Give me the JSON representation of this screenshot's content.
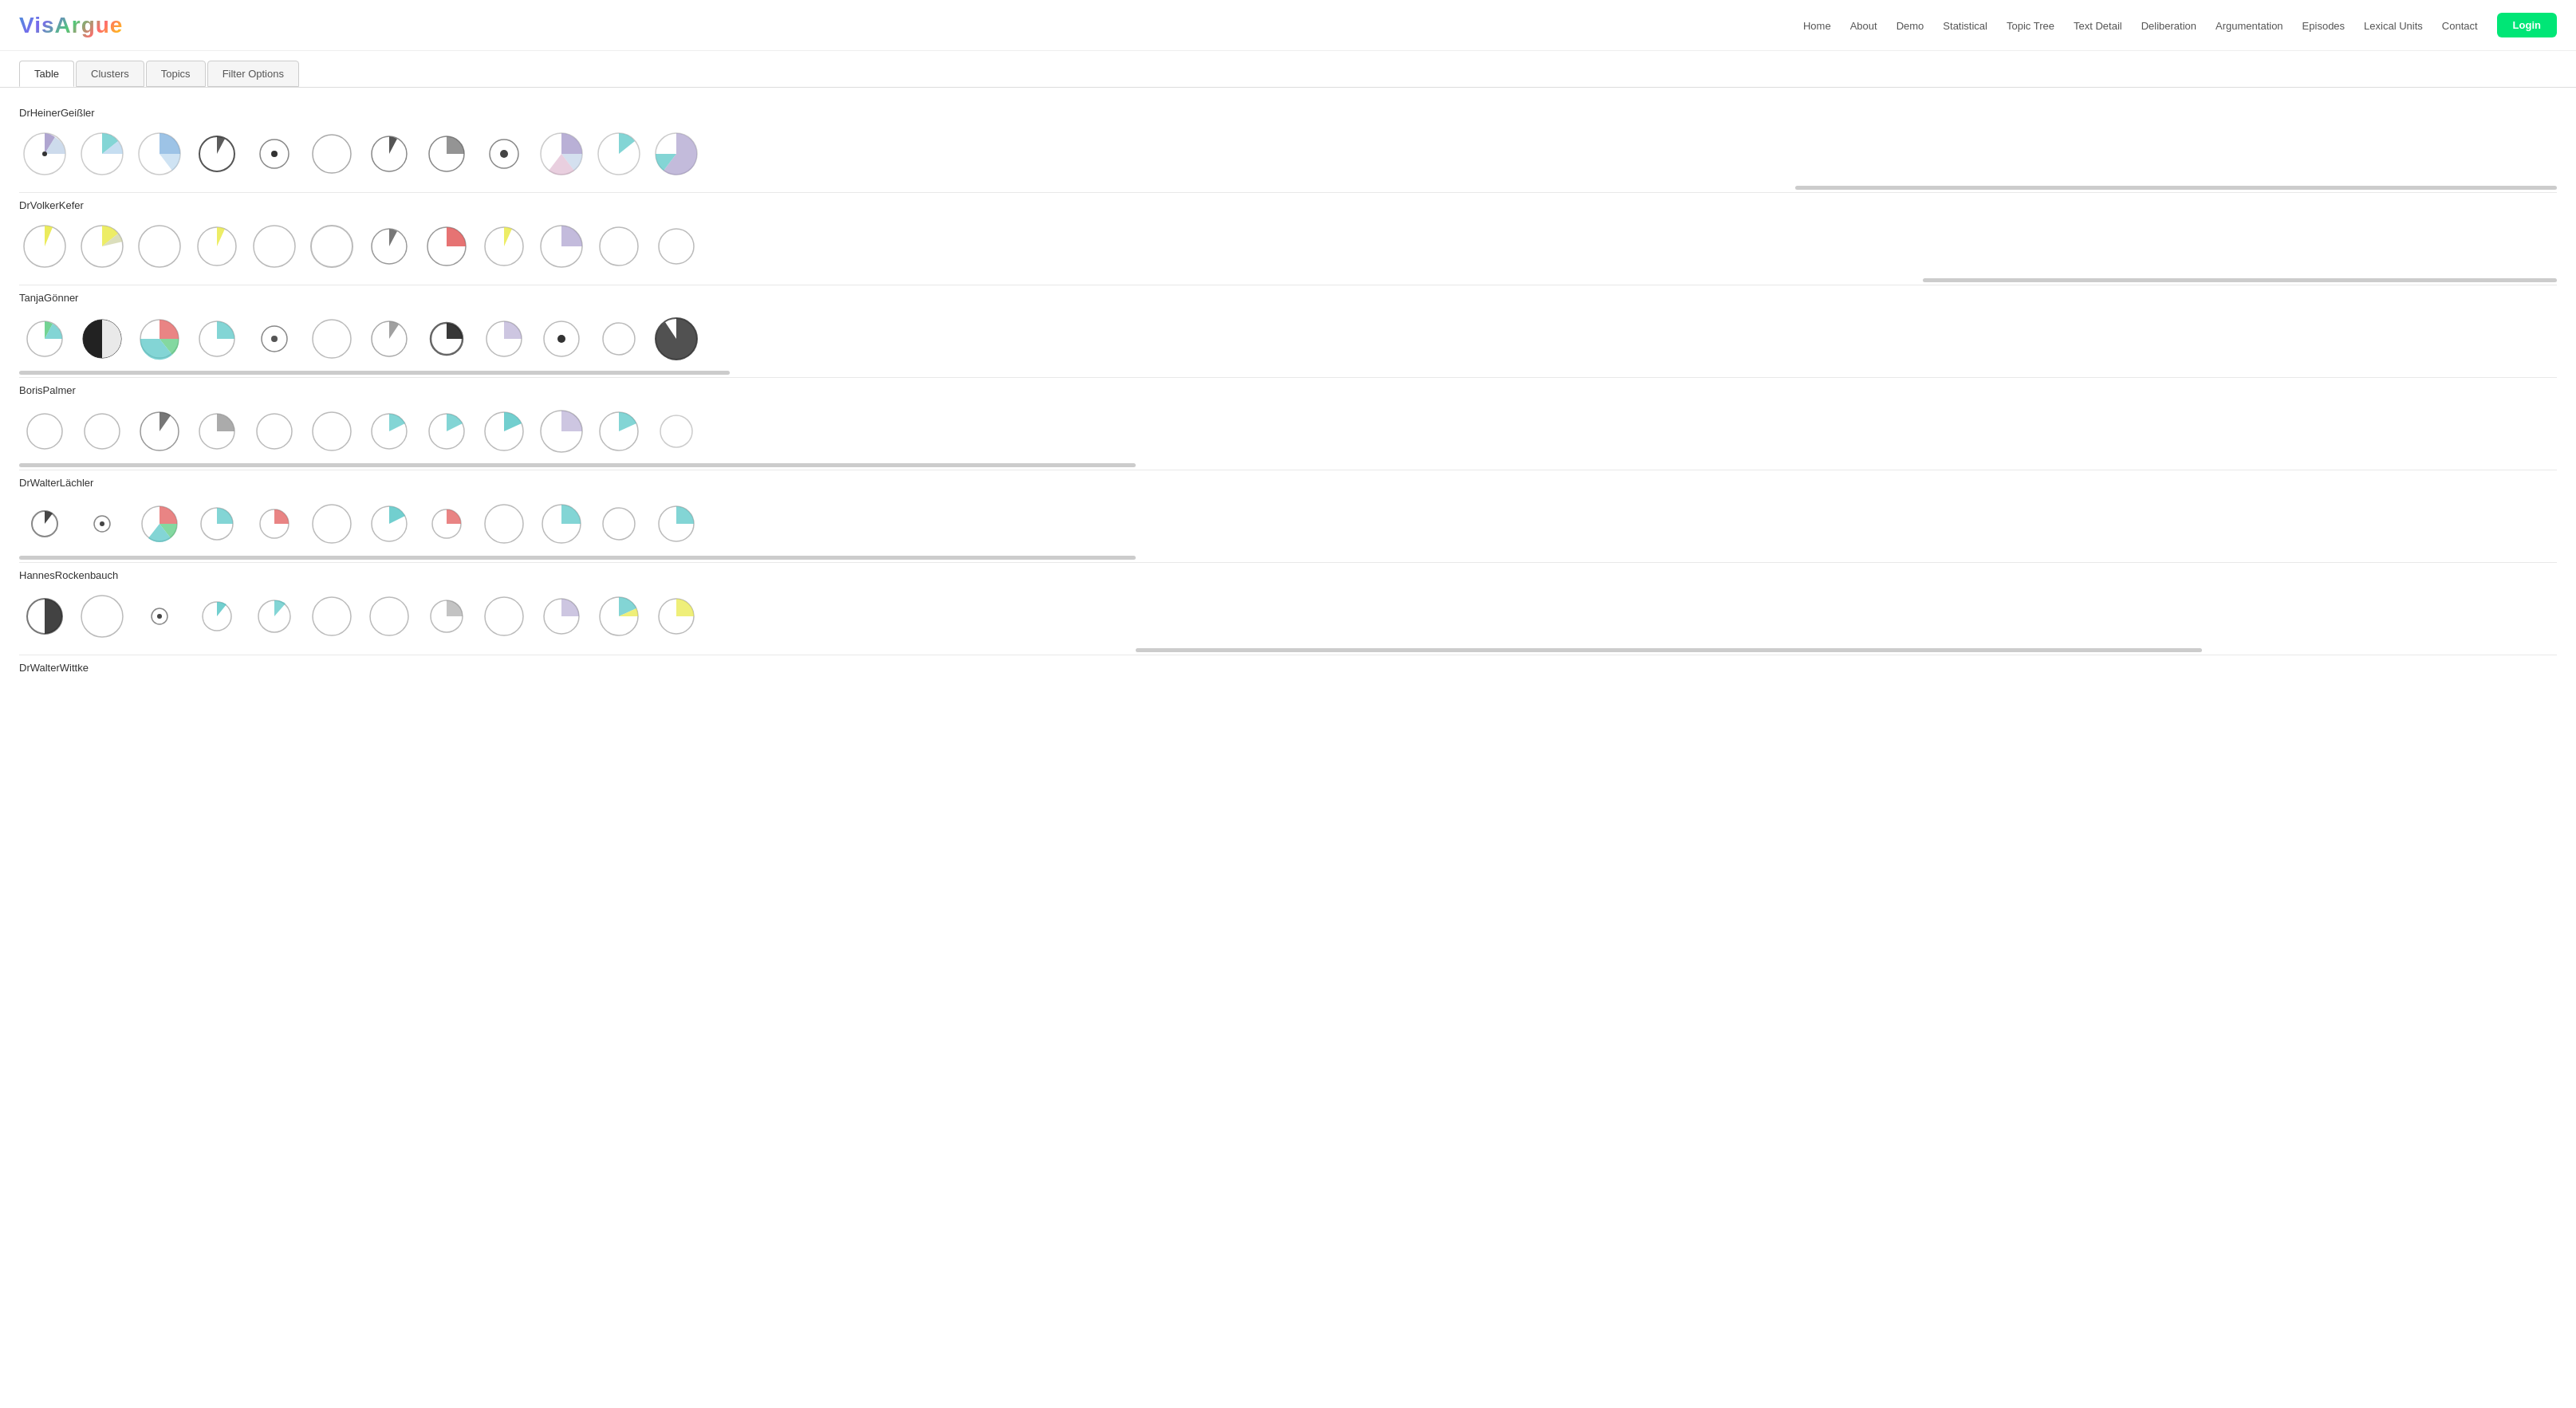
{
  "app": {
    "logo": "VisArgue",
    "nav": [
      {
        "label": "Home",
        "id": "home"
      },
      {
        "label": "About",
        "id": "about"
      },
      {
        "label": "Demo",
        "id": "demo"
      },
      {
        "label": "Statistical",
        "id": "statistical"
      },
      {
        "label": "Topic Tree",
        "id": "topic-tree"
      },
      {
        "label": "Text Detail",
        "id": "text-detail"
      },
      {
        "label": "Deliberation",
        "id": "deliberation"
      },
      {
        "label": "Argumentation",
        "id": "argumentation"
      },
      {
        "label": "Episodes",
        "id": "episodes"
      },
      {
        "label": "Lexical Units",
        "id": "lexical-units"
      },
      {
        "label": "Contact",
        "id": "contact"
      }
    ],
    "login": "Login"
  },
  "tabs": [
    {
      "label": "Table",
      "active": true
    },
    {
      "label": "Clusters",
      "active": false
    },
    {
      "label": "Topics",
      "active": false
    },
    {
      "label": "Filter Options",
      "active": false
    }
  ],
  "persons": [
    {
      "name": "DrHeinerGeißler",
      "scrollWidth": 30,
      "scrollLeft": 70
    },
    {
      "name": "DrVolkerKefer",
      "scrollWidth": 40,
      "scrollLeft": 75
    },
    {
      "name": "TanjaGönner",
      "scrollWidth": 28,
      "scrollLeft": 5
    },
    {
      "name": "BorisPalmer",
      "scrollWidth": 40,
      "scrollLeft": 5
    },
    {
      "name": "DrWalterLächler",
      "scrollWidth": 42,
      "scrollLeft": 5
    },
    {
      "name": "HannesRockenbauch",
      "scrollWidth": 42,
      "scrollLeft": 44
    },
    {
      "name": "DrWalterWittke",
      "scrollWidth": 40,
      "scrollLeft": 20
    }
  ]
}
